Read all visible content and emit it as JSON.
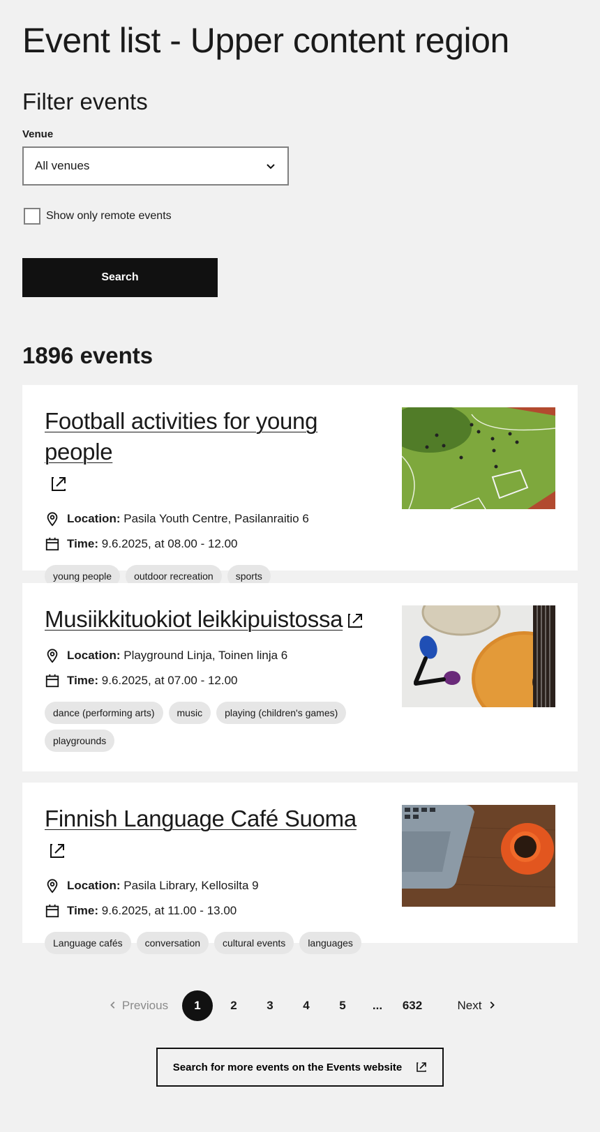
{
  "page": {
    "title": "Event list - Upper content region"
  },
  "filter": {
    "title": "Filter events",
    "venue_label": "Venue",
    "venue_value": "All venues",
    "remote_label": "Show only remote events",
    "remote_checked": false,
    "search_button": "Search"
  },
  "results": {
    "count_text": "1896 events",
    "location_label": "Location:",
    "time_label": "Time:",
    "events": [
      {
        "title": "Football activities for young people",
        "location": "Pasila Youth Centre, Pasilanraitio 6",
        "time": "9.6.2025, at 08.00 - 12.00",
        "tags": [
          "young people",
          "outdoor recreation",
          "sports"
        ]
      },
      {
        "title": "Musiikkituokiot leikkipuistossa",
        "location": "Playground Linja, Toinen linja 6",
        "time": "9.6.2025, at 07.00 - 12.00",
        "tags": [
          "dance (performing arts)",
          "music",
          "playing (children's games)",
          "playgrounds"
        ]
      },
      {
        "title": "Finnish Language Café Suoma",
        "location": "Pasila Library, Kellosilta 9",
        "time": "9.6.2025, at 11.00 - 13.00",
        "tags": [
          "Language cafés",
          "conversation",
          "cultural events",
          "languages"
        ]
      }
    ]
  },
  "pagination": {
    "previous": "Previous",
    "next": "Next",
    "pages": [
      "1",
      "2",
      "3",
      "4",
      "5",
      "...",
      "632"
    ],
    "current": "1"
  },
  "more_events_button": "Search for more events on the Events website"
}
